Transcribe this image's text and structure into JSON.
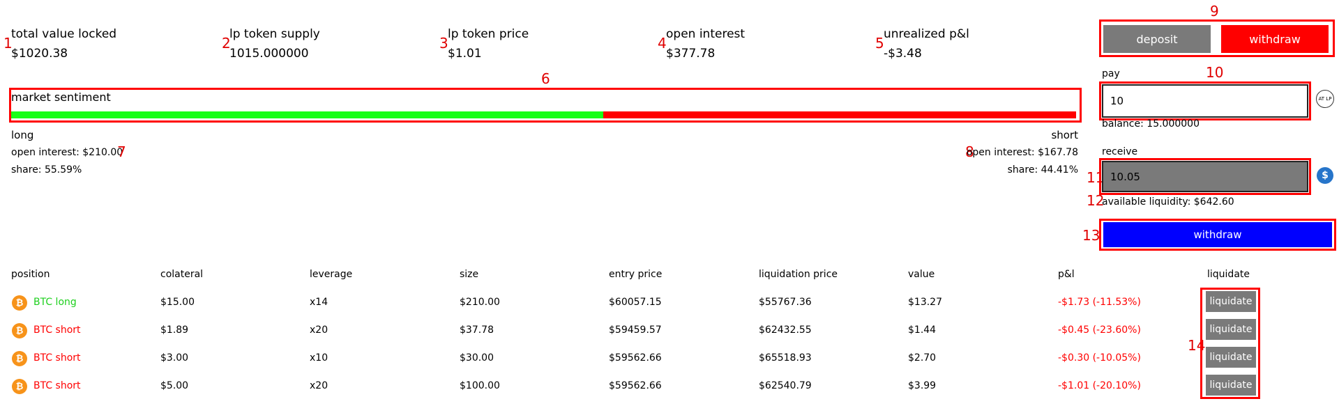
{
  "stats": [
    {
      "label": "total value locked",
      "value": "$1020.38"
    },
    {
      "label": "lp token supply",
      "value": "1015.000000"
    },
    {
      "label": "lp token price",
      "value": "$1.01"
    },
    {
      "label": "open interest",
      "value": "$377.78"
    },
    {
      "label": "unrealized p&l",
      "value": "-$3.48"
    }
  ],
  "sentiment": {
    "title": "market sentiment",
    "long_share": 0.5559,
    "long_label": "long",
    "short_label": "short",
    "long_open_interest": "open interest: $210.00",
    "long_share_text": "share: 55.59%",
    "short_open_interest": "open interest: $167.78",
    "short_share_text": "share: 44.41%",
    "colors": {
      "long": "#18ff18",
      "short": "#ff0000"
    }
  },
  "panel": {
    "deposit_tab": "deposit",
    "withdraw_tab": "withdraw",
    "pay_label": "pay",
    "pay_value": "10",
    "pay_icon_text": "AT LP",
    "balance": "balance: 15.000000",
    "receive_label": "receive",
    "receive_value": "10.05",
    "receive_icon_glyph": "$",
    "available_liquidity": "available liquidity: $642.60",
    "submit_label": "withdraw",
    "colors": {
      "submit": "#0000ff",
      "active_tab": "#ff0000",
      "inactive_tab": "#7a7a7a"
    }
  },
  "table": {
    "headers": [
      "position",
      "colateral",
      "leverage",
      "size",
      "entry price",
      "liquidation price",
      "value",
      "p&l",
      "liquidate"
    ],
    "rows": [
      {
        "coin_glyph": "₿",
        "position": "BTC long",
        "side": "long",
        "collateral": "$15.00",
        "leverage": "x14",
        "size": "$210.00",
        "entry": "$60057.15",
        "liquidation": "$55767.36",
        "value": "$13.27",
        "pnl": "-$1.73 (-11.53%)",
        "action": "liquidate"
      },
      {
        "coin_glyph": "₿",
        "position": "BTC short",
        "side": "short",
        "collateral": "$1.89",
        "leverage": "x20",
        "size": "$37.78",
        "entry": "$59459.57",
        "liquidation": "$62432.55",
        "value": "$1.44",
        "pnl": "-$0.45 (-23.60%)",
        "action": "liquidate"
      },
      {
        "coin_glyph": "₿",
        "position": "BTC short",
        "side": "short",
        "collateral": "$3.00",
        "leverage": "x10",
        "size": "$30.00",
        "entry": "$59562.66",
        "liquidation": "$65518.93",
        "value": "$2.70",
        "pnl": "-$0.30 (-10.05%)",
        "action": "liquidate"
      },
      {
        "coin_glyph": "₿",
        "position": "BTC short",
        "side": "short",
        "collateral": "$5.00",
        "leverage": "x20",
        "size": "$100.00",
        "entry": "$59562.66",
        "liquidation": "$62540.79",
        "value": "$3.99",
        "pnl": "-$1.01 (-20.10%)",
        "action": "liquidate"
      }
    ]
  },
  "annotations": [
    "1",
    "2",
    "3",
    "4",
    "5",
    "6",
    "7",
    "8",
    "9",
    "10",
    "11",
    "12",
    "13",
    "14"
  ]
}
